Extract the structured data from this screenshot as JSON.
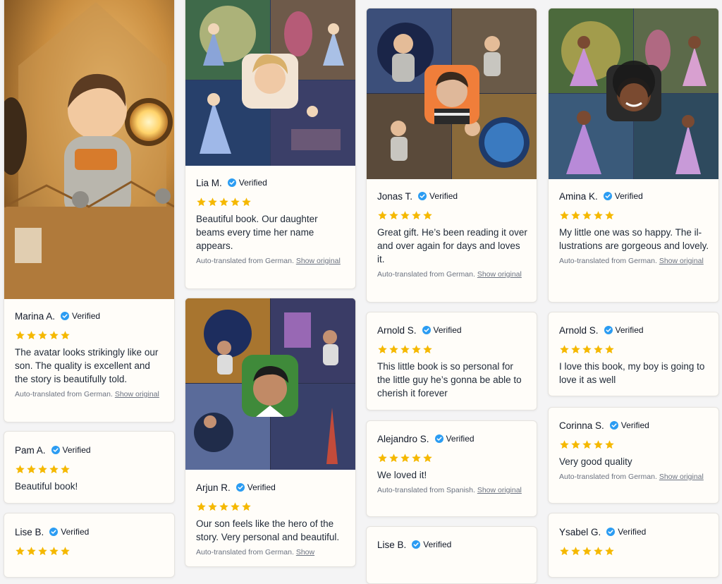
{
  "verified_label": "Verified",
  "colors": {
    "star": "#f5b800",
    "badge": "#2b9cf2"
  },
  "reviews": [
    {
      "name": "Marina A.",
      "text": "The avatar looks strikingly like our son. The quality is excellent and the story is beautifully told.",
      "note": "Auto-translated from German.",
      "link": "Show original"
    },
    {
      "name": "Pam A.",
      "text": "Beautiful book!"
    },
    {
      "name": "Lise B."
    },
    {
      "name": "Lia M.",
      "text": "Beautiful book. Our daughter beams every time her name appears.",
      "note": "Auto-translated from German.",
      "link": "Show original"
    },
    {
      "name": "Arjun R.",
      "text": "Our son feels like the hero of the story. Very personal and beautiful.",
      "note": "Auto-translated from German.",
      "link": "Show"
    },
    {
      "name": "Jonas T.",
      "text": "Great gift. He’s been reading it over and over again for days and loves it.",
      "note": "Auto-translated from German.",
      "link": "Show original"
    },
    {
      "name": "Arnold S.",
      "text": "This little book is so personal for the little guy he’s gonna be able to cherish it forever"
    },
    {
      "name": "Alejandro S.",
      "text": "We loved it!",
      "note": "Auto-translated from Spanish.",
      "link": "Show original"
    },
    {
      "name": "Lise B."
    },
    {
      "name": "Amina K.",
      "text": "My little one was so happy. The il-lustrations are gorgeous and lovely.",
      "note": "Auto-translated from German.",
      "link": "Show original"
    },
    {
      "name": "Arnold S.",
      "text": "I love this book, my boy is going to love it as well"
    },
    {
      "name": "Corinna S.",
      "text": "Very good quality",
      "note": "Auto-translated from German.",
      "link": "Show original"
    },
    {
      "name": "Ysabel G."
    }
  ],
  "images": {
    "marina": "astronaut-boy-cardboard-rocket-illustration",
    "lia": "fairy-princess-collage-with-girl-photo",
    "arjun": "space-boy-collage-with-boy-photo",
    "jonas": "astronaut-boy-collage-with-boy-photo",
    "amina": "fairy-princess-collage-with-girl-photo"
  }
}
